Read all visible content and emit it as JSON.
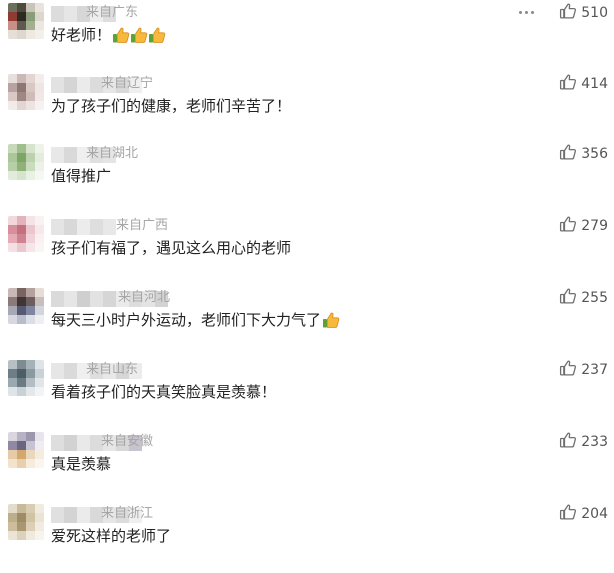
{
  "comments": [
    {
      "location": "来自广东",
      "text": "好老师！",
      "emoji_count": 3,
      "likes": "510",
      "has_menu": true,
      "avatar": [
        "#6b6f5c",
        "#4e4b3e",
        "#c9c4b8",
        "#e9e4db",
        "#8f3b33",
        "#2d2a22",
        "#8a9d7a",
        "#dcd7cc",
        "#c88f86",
        "#5f5a4f",
        "#a3b08f",
        "#ece8e1",
        "#e6dfd7",
        "#ded7ce",
        "#eee9e3",
        "#f3f0ec"
      ],
      "nick": [
        "#dcdcdc",
        "#e6e6e6",
        "#d7d7d7",
        "#ededed",
        "#dedede"
      ]
    },
    {
      "location": "来自辽宁",
      "text": "为了孩子们的健康，老师们辛苦了！",
      "emoji_count": 0,
      "likes": "414",
      "has_menu": false,
      "avatar": [
        "#e8dedd",
        "#cbb9b7",
        "#e3d5d2",
        "#f2ecea",
        "#b9a3a0",
        "#8c7773",
        "#d8c7c4",
        "#efe6e4",
        "#d9c8c5",
        "#9f8884",
        "#cfbcb9",
        "#f0e8e6",
        "#f1ebea",
        "#e2d6d4",
        "#ede4e2",
        "#f6f2f1"
      ],
      "nick": [
        "#e2e2e2",
        "#d5d5d5",
        "#ebebeb",
        "#dcdcdc",
        "#e6e6e6",
        "#d9d9d9",
        "#efefef"
      ]
    },
    {
      "location": "来自湖北",
      "text": "值得推广",
      "emoji_count": 0,
      "likes": "356",
      "has_menu": false,
      "avatar": [
        "#c7d9b8",
        "#9fbe8c",
        "#d7e4cd",
        "#eef3ea",
        "#a9c797",
        "#7da568",
        "#bcd2ad",
        "#e4eddd",
        "#b7cfa7",
        "#8fb27b",
        "#c9dcbd",
        "#ecf2e7",
        "#e3ecdc",
        "#d6e4cb",
        "#e9f0e4",
        "#f5f8f2"
      ],
      "nick": [
        "#e8e8e8",
        "#d9d9d9",
        "#efefef",
        "#e0e0e0",
        "#e5e5e5"
      ]
    },
    {
      "location": "来自广西",
      "text": "孩子们有福了，遇见这么用心的老师",
      "emoji_count": 0,
      "likes": "279",
      "has_menu": false,
      "avatar": [
        "#f0d8dc",
        "#e2b3bb",
        "#f5e4e7",
        "#faf1f2",
        "#d88e9b",
        "#c4707f",
        "#ecc6cd",
        "#f7e8eb",
        "#e6aab5",
        "#cf8290",
        "#f1d2d8",
        "#faeff1",
        "#f4e0e4",
        "#ebc8cf",
        "#f6e6e9",
        "#fbf4f5"
      ],
      "nick": [
        "#e4e4e4",
        "#d8d8d8",
        "#ececec",
        "#dedede",
        "#e8e8e8"
      ]
    },
    {
      "location": "来自河北",
      "text": "每天三小时户外运动，老师们下大力气了",
      "emoji_count": 1,
      "likes": "255",
      "has_menu": false,
      "avatar": [
        "#c9b9b6",
        "#7a6462",
        "#b5a19d",
        "#e6ddd9",
        "#8c7a78",
        "#3f3436",
        "#6d5e5d",
        "#c9bebb",
        "#a7a8b6",
        "#555a72",
        "#7f859f",
        "#d2d4de",
        "#d7d7df",
        "#b9bccb",
        "#dcdee6",
        "#eeeff3"
      ],
      "nick": [
        "#dadada",
        "#e6e6e6",
        "#cfcfcf",
        "#e2e2e2",
        "#d6d6d6",
        "#ebebeb",
        "#dddddd",
        "#e4e4e4",
        "#d3d3d3"
      ]
    },
    {
      "location": "来自山东",
      "text": "看着孩子们的天真笑脸真是羡慕！",
      "emoji_count": 0,
      "likes": "237",
      "has_menu": false,
      "avatar": [
        "#b8c0c4",
        "#7d8c93",
        "#a5b3b9",
        "#dde3e6",
        "#6e7e86",
        "#4e5e67",
        "#8a9aa1",
        "#c9d2d6",
        "#9aa9af",
        "#6a7b83",
        "#b2bec3",
        "#e0e6e8",
        "#dfe4e6",
        "#c8d1d5",
        "#e4e8ea",
        "#f1f4f5"
      ],
      "nick": [
        "#e6e6e6",
        "#dadada",
        "#efefef",
        "#dedede",
        "#e8e8e8",
        "#d6d6d6",
        "#ececec"
      ]
    },
    {
      "location": "来自安徽",
      "text": "真是羡慕",
      "emoji_count": 0,
      "likes": "233",
      "has_menu": false,
      "avatar": [
        "#d9d6e0",
        "#b7b2c4",
        "#9d97ae",
        "#e7e5ec",
        "#8f8aa2",
        "#6b6580",
        "#c8c3d3",
        "#efedf2",
        "#e6cba6",
        "#d4a86d",
        "#ead8bd",
        "#f5ece0",
        "#f3e3cc",
        "#e9d0ad",
        "#f6ecdd",
        "#faf5ee"
      ],
      "nick": [
        "#dedede",
        "#d2d2d2",
        "#e9e9e9",
        "#dcdcdc",
        "#e6e6e6",
        "#d8d8d8",
        "#c7c4cf"
      ]
    },
    {
      "location": "来自浙江",
      "text": "爱死这样的老师了",
      "emoji_count": 0,
      "likes": "204",
      "has_menu": false,
      "avatar": [
        "#e4dccb",
        "#c8b99a",
        "#d9ccb1",
        "#f0ebe1",
        "#bfae8b",
        "#9e8c67",
        "#d2c3a3",
        "#ebe3d4",
        "#cdbd9c",
        "#a99770",
        "#dccfb6",
        "#f1ece3",
        "#ebe4d6",
        "#ddd1bb",
        "#efe9de",
        "#f7f4ee"
      ],
      "nick": [
        "#e0e0e0",
        "#d4d4d4",
        "#ebebeb",
        "#d9d9d9",
        "#e6e6e6",
        "#dcdcdc",
        "#efefef"
      ]
    }
  ],
  "colors": {
    "location": "#a6a6a6",
    "text": "#222222",
    "likes": "#555555",
    "thumb_outline": "#6f6f6f",
    "emoji_yellow": "#f6b93b",
    "emoji_green": "#5fa135"
  }
}
